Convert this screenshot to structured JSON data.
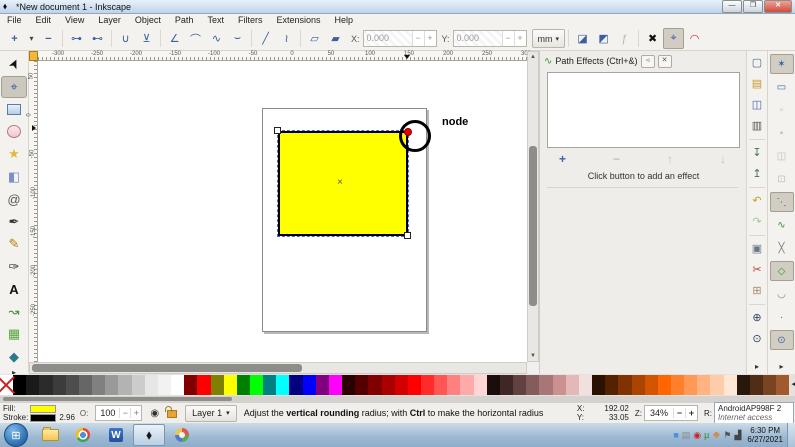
{
  "window": {
    "title": "*New document 1 - Inkscape",
    "min": "—",
    "restore": "❐",
    "close": "✕"
  },
  "menu": {
    "items": [
      "File",
      "Edit",
      "View",
      "Layer",
      "Object",
      "Path",
      "Text",
      "Filters",
      "Extensions",
      "Help"
    ]
  },
  "tool_controls": {
    "left_buttons": [
      {
        "name": "insert-node",
        "glyph": "+",
        "bold": true
      },
      {
        "name": "insert-node-options",
        "glyph": "▾",
        "small": true
      },
      {
        "name": "delete-node",
        "glyph": "−",
        "bold": true
      },
      {
        "sep": true
      },
      {
        "name": "join-nodes",
        "glyph": "⊶"
      },
      {
        "name": "break-nodes",
        "glyph": "⊷"
      },
      {
        "sep": true
      },
      {
        "name": "join-with-segment",
        "glyph": "∪"
      },
      {
        "name": "delete-segment",
        "glyph": "⊻"
      },
      {
        "sep": true
      },
      {
        "name": "node-corner",
        "glyph": "∠"
      },
      {
        "name": "node-smooth",
        "glyph": "⌒"
      },
      {
        "name": "node-symmetric",
        "glyph": "∿"
      },
      {
        "name": "node-auto-smooth",
        "glyph": "⌣"
      },
      {
        "sep": true
      },
      {
        "name": "segment-line",
        "glyph": "╱"
      },
      {
        "name": "segment-curve",
        "glyph": "≀"
      },
      {
        "sep": true
      },
      {
        "name": "object-to-path",
        "glyph": "▱"
      },
      {
        "name": "stroke-to-path",
        "glyph": "▰"
      }
    ],
    "x_label": "X:",
    "x_value": "0.000",
    "y_label": "Y:",
    "y_value": "0.000",
    "spin_minus": "−",
    "spin_plus": "+",
    "unit": "mm",
    "unit_arrow": "▾",
    "right_buttons": [
      {
        "name": "edit-clipping-path",
        "glyph": "◪"
      },
      {
        "name": "edit-mask",
        "glyph": "◩"
      },
      {
        "name": "next-lpe-parameter",
        "glyph": "ƒ",
        "disabled": true
      },
      {
        "sep": true
      },
      {
        "name": "show-transform-handles",
        "glyph": "✖",
        "color": "#111111"
      },
      {
        "name": "show-bezier-handles",
        "glyph": "⌖",
        "pressed": true
      },
      {
        "name": "show-path-outline",
        "glyph": "◠",
        "color": "#c03030"
      }
    ]
  },
  "toolbox": {
    "tools": [
      {
        "name": "tool-selector",
        "glyph": "➤",
        "color": "#111111"
      },
      {
        "name": "tool-node",
        "glyph": "⌖",
        "color": "#3465a4",
        "selected": true
      },
      {
        "name": "tool-rectangle",
        "shape": "rect"
      },
      {
        "name": "tool-ellipse",
        "shape": "ellipse"
      },
      {
        "name": "tool-star",
        "glyph": "★",
        "color": "#e2b93c"
      },
      {
        "name": "tool-3dbox",
        "glyph": "◧",
        "color": "#7d8fc9"
      },
      {
        "name": "tool-spiral",
        "glyph": "@",
        "color": "#555555"
      },
      {
        "name": "tool-pen",
        "glyph": "✒",
        "color": "#333333"
      },
      {
        "name": "tool-pencil",
        "glyph": "✎",
        "color": "#b08000"
      },
      {
        "name": "tool-calligraphy",
        "glyph": "✑",
        "color": "#333333"
      },
      {
        "name": "tool-text",
        "glyph": "A",
        "color": "#111111",
        "bold": true
      },
      {
        "name": "tool-connector",
        "glyph": "↝",
        "color": "#3a8f3a"
      },
      {
        "name": "tool-mesh",
        "glyph": "▦",
        "color": "#57a639"
      },
      {
        "name": "tool-dropper",
        "glyph": "◆",
        "color": "#2a7a8a"
      }
    ],
    "overflow_arrow": "▸"
  },
  "rulers": {
    "h_labels": [
      "-300",
      "-250",
      "-200",
      "-150",
      "-100",
      "-50",
      "0",
      "50",
      "100",
      "150",
      "200",
      "250",
      "300"
    ],
    "v_labels": [
      "50",
      "0",
      "-50",
      "-100",
      "-150",
      "-200",
      "-250"
    ]
  },
  "canvas": {
    "node_label": "node",
    "center_mark": "×",
    "rect_fill": "#ffff00",
    "node_color": "#e80000"
  },
  "path_effects": {
    "title": "Path Effects (Ctrl+&)",
    "panel_icon": "∿",
    "iconify_btn": "◃",
    "close_btn": "✕",
    "add_btn": "+",
    "remove_btn": "−",
    "up_btn": "↑",
    "down_btn": "↓",
    "hint": "Click button to add an effect"
  },
  "commands_bar": [
    {
      "name": "document-properties",
      "glyph": "▢",
      "color": "#446688"
    },
    {
      "name": "open-document",
      "glyph": "▤",
      "color": "#c9972a"
    },
    {
      "name": "save-document",
      "glyph": "◫",
      "color": "#4466aa"
    },
    {
      "name": "print-document",
      "glyph": "▥",
      "color": "#555555"
    },
    {
      "sep": true
    },
    {
      "name": "import-bitmap",
      "glyph": "↧",
      "color": "#447744"
    },
    {
      "name": "export-bitmap",
      "glyph": "↥",
      "color": "#447744"
    },
    {
      "sep": true
    },
    {
      "name": "undo",
      "glyph": "↶",
      "color": "#c8a020"
    },
    {
      "name": "redo",
      "glyph": "↷",
      "color": "#99cc99",
      "disabled": true
    },
    {
      "sep": true
    },
    {
      "name": "copy",
      "glyph": "▣",
      "color": "#667788"
    },
    {
      "name": "cut",
      "glyph": "✂",
      "color": "#cc3333"
    },
    {
      "name": "paste",
      "glyph": "⊞",
      "color": "#aa8866"
    },
    {
      "sep": true
    },
    {
      "name": "zoom-selection",
      "glyph": "⊕",
      "color": "#334466"
    },
    {
      "name": "zoom-drawing",
      "glyph": "⊙",
      "color": "#334466"
    }
  ],
  "commands_overflow": "▸",
  "snap_bar": [
    {
      "name": "snap-enable",
      "glyph": "✶",
      "color": "#3465a4",
      "pressed": true
    },
    {
      "name": "snap-bounding-box",
      "glyph": "▭",
      "color": "#3465a4"
    },
    {
      "name": "snap-bbox-edges",
      "glyph": "▫",
      "disabled": true
    },
    {
      "name": "snap-bbox-corners",
      "glyph": "▪",
      "disabled": true
    },
    {
      "name": "snap-bbox-edge-midpoints",
      "glyph": "◫",
      "disabled": true
    },
    {
      "name": "snap-bbox-centers",
      "glyph": "⊡",
      "disabled": true
    },
    {
      "name": "snap-nodes",
      "glyph": "⋱",
      "color": "#3465a4",
      "pressed": true
    },
    {
      "name": "snap-paths",
      "glyph": "∿",
      "color": "#3a8f3a"
    },
    {
      "name": "snap-path-intersections",
      "glyph": "╳",
      "color": "#777777"
    },
    {
      "name": "snap-cusp-nodes",
      "glyph": "◇",
      "color": "#3a8f3a",
      "pressed": true
    },
    {
      "name": "snap-smooth-nodes",
      "glyph": "◡",
      "color": "#777777"
    },
    {
      "name": "snap-midpoints",
      "glyph": "∙",
      "color": "#cc3333"
    },
    {
      "name": "snap-others",
      "glyph": "⊙",
      "color": "#3465a4",
      "pressed": true
    }
  ],
  "snap_overflow": "▸",
  "palette": {
    "colors": [
      "none",
      "#000000",
      "#1a1a1a",
      "#2b2b2b",
      "#3c3c3c",
      "#4d4d4d",
      "#666666",
      "#808080",
      "#999999",
      "#b3b3b3",
      "#cccccc",
      "#e6e6e6",
      "#f2f2f2",
      "#ffffff",
      "#800000",
      "#ff0000",
      "#808000",
      "#ffff00",
      "#008000",
      "#00ff00",
      "#008080",
      "#00ffff",
      "#000080",
      "#0000ff",
      "#800080",
      "#ff00ff",
      "#2b0000",
      "#550000",
      "#800000",
      "#aa0000",
      "#d40000",
      "#ff0000",
      "#ff2a2a",
      "#ff5555",
      "#ff8080",
      "#ffaaaa",
      "#ffd5d5",
      "#1c0d0d",
      "#3f2727",
      "#624141",
      "#855c5c",
      "#a87676",
      "#cb9090",
      "#e4b8b8",
      "#f2e0e0",
      "#2b1100",
      "#552200",
      "#803300",
      "#aa4400",
      "#d45500",
      "#ff6600",
      "#ff7f2a",
      "#ff9955",
      "#ffb380",
      "#ffccaa",
      "#ffe6d5",
      "#28170b",
      "#502d16",
      "#784421",
      "#a05a2c"
    ],
    "overflow_arrow": "◂"
  },
  "status_bar": {
    "fill_label": "Fill:",
    "stroke_label": "Stroke:",
    "fill_color": "#ffff00",
    "stroke_color": "#000000",
    "stroke_width": "2.96",
    "opacity_label": "O:",
    "opacity_value": "100",
    "minus": "−",
    "plus": "+",
    "layer_label": "Layer 1",
    "layer_arrow": "▾",
    "eye_glyph": "◉",
    "message_parts": [
      {
        "t": "Adjust the ",
        "b": false
      },
      {
        "t": "vertical rounding",
        "b": true
      },
      {
        "t": " radius; with ",
        "b": false
      },
      {
        "t": "Ctrl",
        "b": true
      },
      {
        "t": " to make the horizontal radius the same",
        "b": false
      }
    ],
    "x_label": "X:",
    "x_value": "192.02",
    "y_label": "Y:",
    "y_value": "33.05",
    "z_label": "Z:",
    "zoom_value": "34%",
    "r_label": "R:",
    "tooltip_line1": "AndroidAP998F 2",
    "tooltip_line2": "Internet access"
  },
  "taskbar": {
    "start_glyph": "⊞",
    "word_letter": "W",
    "inkscape_glyph": "⬧",
    "tray": [
      {
        "name": "tray-icon-1",
        "glyph": "■",
        "color": "#4a90d9"
      },
      {
        "name": "tray-icon-2",
        "glyph": "▤",
        "color": "#888888"
      },
      {
        "name": "tray-icon-3",
        "glyph": "◉",
        "color": "#cc2222"
      },
      {
        "name": "tray-icon-4",
        "glyph": "µ",
        "color": "#2a8f2a"
      },
      {
        "name": "tray-icon-5",
        "glyph": "❖",
        "color": "#d97e2a"
      },
      {
        "name": "tray-icon-6",
        "glyph": "⚑",
        "color": "#555555"
      },
      {
        "name": "tray-icon-7",
        "glyph": "▟",
        "color": "#444444"
      }
    ],
    "clock_time": "6:30 PM",
    "clock_date": "6/27/2021"
  }
}
